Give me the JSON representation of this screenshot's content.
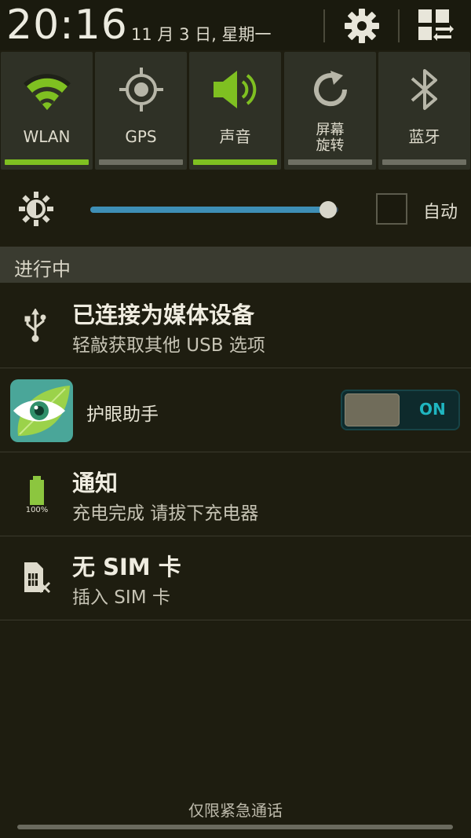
{
  "status": {
    "time": "20:16",
    "date": "11 月 3 日, 星期一",
    "settings_icon": "gear-icon",
    "panel_icon": "grid-switch-icon"
  },
  "toggles": [
    {
      "label": "WLAN",
      "icon": "wifi-icon",
      "active": true
    },
    {
      "label": "GPS",
      "icon": "gps-icon",
      "active": false
    },
    {
      "label": "声音",
      "icon": "speaker-icon",
      "active": true
    },
    {
      "label": "屏幕\n旋转",
      "icon": "rotate-icon",
      "active": false
    },
    {
      "label": "蓝牙",
      "icon": "bluetooth-icon",
      "active": false
    }
  ],
  "brightness": {
    "level": 0.96,
    "auto_label": "自动",
    "auto_checked": false
  },
  "section": {
    "title": "进行中"
  },
  "notifications": {
    "usb": {
      "title": "已连接为媒体设备",
      "subtitle": "轻敲获取其他 USB 选项"
    },
    "eye_app": {
      "title": "护眼助手",
      "switch_label": "ON",
      "on": true
    },
    "charge": {
      "title": "通知",
      "subtitle": "充电完成 请拔下充电器",
      "battery_label": "100%"
    },
    "sim": {
      "title": "无 SIM 卡",
      "subtitle": "插入 SIM 卡"
    }
  },
  "footer": {
    "text": "仅限紧急通话"
  },
  "colors": {
    "accent_green": "#7fc021",
    "switch_cyan": "#1fb5c0",
    "slider_blue": "#3e8fb6"
  }
}
